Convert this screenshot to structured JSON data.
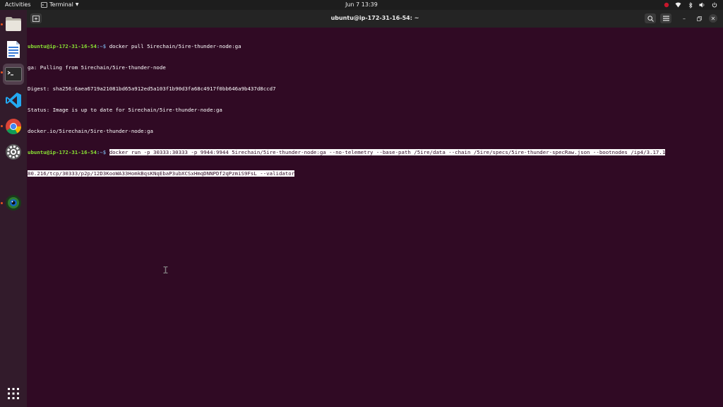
{
  "topbar": {
    "activities": "Activities",
    "app_name": "Terminal",
    "clock": "Jun 7  13:39",
    "tray_icons": [
      "record-indicator-icon",
      "wifi-icon",
      "bluetooth-icon",
      "volume-icon",
      "power-icon"
    ]
  },
  "dock": {
    "apps": [
      "files",
      "text-editor",
      "terminal",
      "vscode",
      "chrome",
      "settings",
      "camera-app"
    ],
    "show_apps": "show-applications-grid"
  },
  "window": {
    "title": "ubuntu@ip-172-31-16-54: ~"
  },
  "terminal": {
    "prompt_user": "ubuntu@ip-172-31-16-54",
    "prompt_path": ":~$",
    "cmd1": " docker pull 5irechain/5ire-thunder-node:ga",
    "out1": "ga: Pulling from 5irechain/5ire-thunder-node",
    "out2": "Digest: sha256:6aea6719a21081bd65a912ed5a103f1b90d3fa68c4917f0bb646a9b437d8ccd7",
    "out3": "Status: Image is up to date for 5irechain/5ire-thunder-node:ga",
    "out4": "docker.io/5irechain/5ire-thunder-node:ga",
    "cmd2_part1": "docker run -p 30333:30333 -p 9944:9944 5irechain/5ire-thunder-node:ga --no-telemetry --base-path /5ire/data --chain /5ire/specs/5ire-thunder-specRaw.json --bootnodes /ip4/3.17.1",
    "cmd2_part2": "80.216/tcp/30333/p2p/12D3KooWA33HomkBqsKNqEbaP3ubXCSxHmqDNNPDf2qPzmiS9FsL --validator"
  },
  "colors": {
    "terminal_bg": "#300a24",
    "prompt_user": "#8ae234",
    "prompt_path": "#729fcf",
    "topbar_bg": "#1d1d1d",
    "dock_bg": "#321b2b",
    "accent": "#e95420"
  }
}
